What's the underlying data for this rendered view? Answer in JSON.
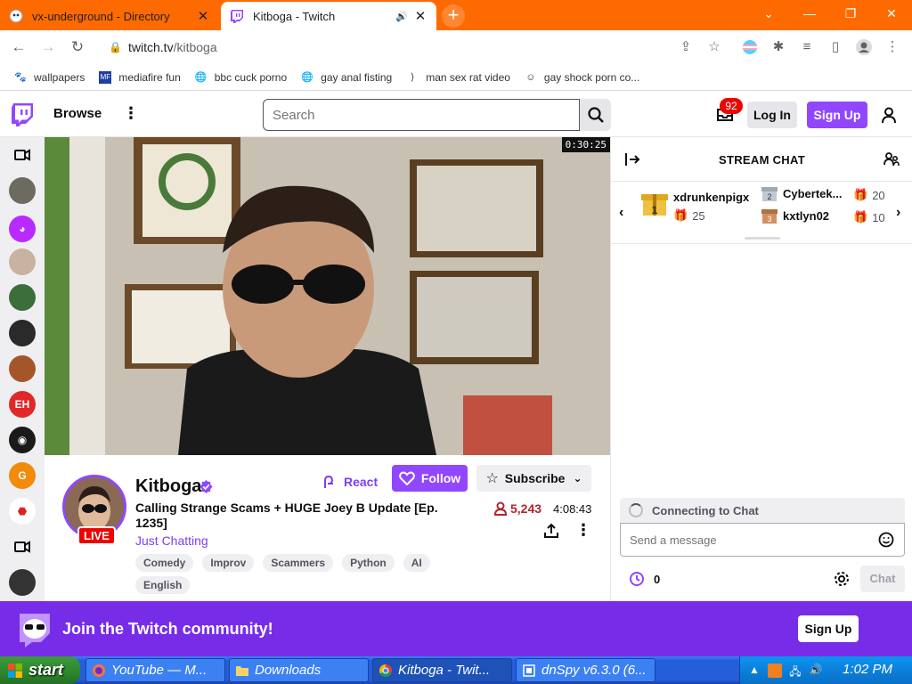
{
  "browser": {
    "tabs": [
      {
        "title": "vx-underground - Directory",
        "active": false
      },
      {
        "title": "Kitboga - Twitch",
        "active": true
      }
    ],
    "address": {
      "host": "twitch.tv",
      "path": "/kitboga"
    },
    "bookmarks": [
      {
        "label": "wallpapers"
      },
      {
        "label": "mediafire fun"
      },
      {
        "label": "bbc cuck porno"
      },
      {
        "label": "gay anal fisting"
      },
      {
        "label": "man sex rat video"
      },
      {
        "label": "gay shock porn co..."
      }
    ]
  },
  "twitch": {
    "nav": {
      "browse": "Browse",
      "search_placeholder": "Search",
      "notifications": "92",
      "login": "Log In",
      "signup": "Sign Up"
    },
    "video": {
      "timer": "0:30:25"
    },
    "channel": {
      "name": "Kitboga",
      "live": "LIVE",
      "title": "Calling Strange Scams + HUGE Joey B Update [Ep. 1235]",
      "category": "Just Chatting",
      "tags": [
        "Comedy",
        "Improv",
        "Scammers",
        "Python",
        "AI",
        "English"
      ],
      "react": "React",
      "follow": "Follow",
      "subscribe": "Subscribe",
      "viewers": "5,243",
      "uptime": "4:08:43"
    },
    "chat": {
      "header": "STREAM CHAT",
      "gifters": [
        {
          "rank": "1",
          "name": "xdrunkenpigx",
          "count": "25"
        },
        {
          "rank": "2",
          "name": "Cybertek...",
          "count": "20"
        },
        {
          "rank": "3",
          "name": "kxtlyn02",
          "count": "10"
        }
      ],
      "connecting": "Connecting to Chat",
      "input_placeholder": "Send a message",
      "points": "0",
      "chat_button": "Chat"
    },
    "banner": {
      "text": "Join the Twitch community!",
      "signup": "Sign Up"
    }
  },
  "taskbar": {
    "start": "start",
    "tasks": [
      {
        "label": "YouTube — M..."
      },
      {
        "label": "Downloads"
      },
      {
        "label": "Kitboga - Twit..."
      },
      {
        "label": "dnSpy v6.3.0 (6..."
      }
    ],
    "clock": "1:02 PM"
  },
  "colors": {
    "twitch_purple": "#9147ff",
    "banner_purple": "#772ce8",
    "chrome_orange": "#ff6a00",
    "live_red": "#eb0400"
  }
}
